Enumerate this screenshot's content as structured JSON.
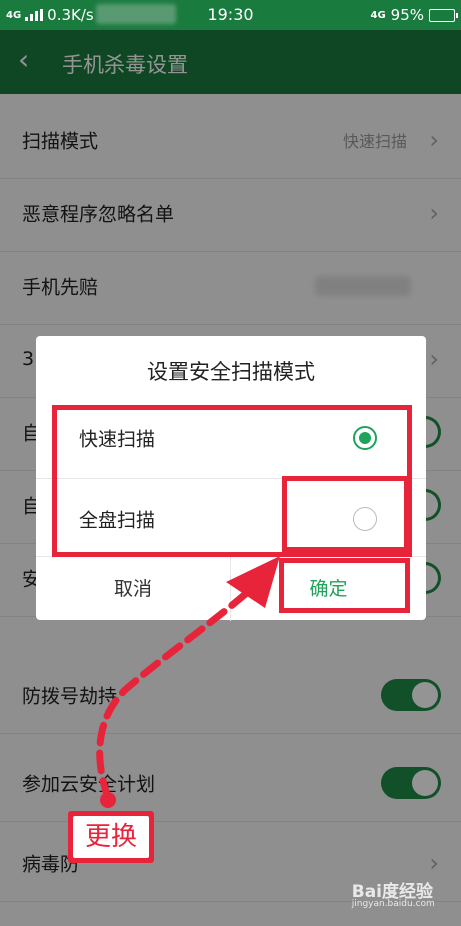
{
  "status_bar": {
    "network_left": "4G",
    "speed": "0.3K/s",
    "time": "19:30",
    "network_right": "4G",
    "battery": "95%"
  },
  "app_bar": {
    "back_icon": "chevron-left-icon",
    "title": "手机杀毒设置"
  },
  "settings": {
    "rows": [
      {
        "label": "扫描模式",
        "value": "快速扫描"
      },
      {
        "label": "恶意程序忽略名单"
      },
      {
        "label": "手机先赔"
      },
      {
        "label": "3"
      },
      {
        "label": "自"
      },
      {
        "label": "自"
      },
      {
        "label": "安"
      },
      {
        "label": "防拨号劫持"
      },
      {
        "label": "参加云安全计划"
      },
      {
        "label": "病毒防"
      }
    ]
  },
  "dialog": {
    "title": "设置安全扫描模式",
    "options": [
      {
        "label": "快速扫描",
        "selected": true
      },
      {
        "label": "全盘扫描",
        "selected": false
      }
    ],
    "cancel_label": "取消",
    "confirm_label": "确定"
  },
  "annotation": {
    "label": "更换",
    "color": "#e8243a"
  },
  "watermark": {
    "brand": "Bai度经验",
    "url": "jingyan.baidu.com"
  },
  "colors": {
    "header_green": "#1a7b3f",
    "accent_green": "#1ea35a",
    "highlight_red": "#e8243a"
  }
}
